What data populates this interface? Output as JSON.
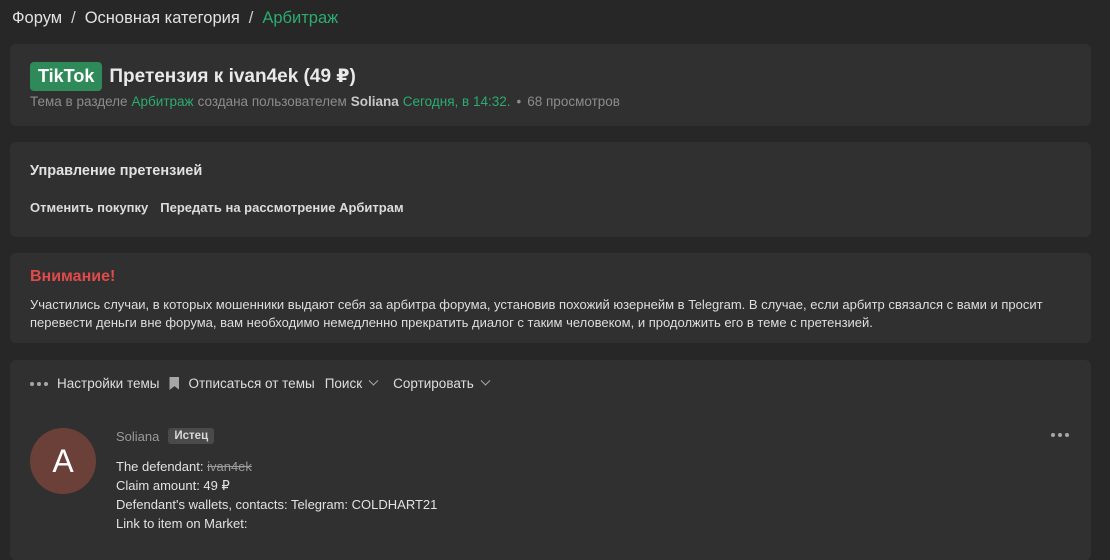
{
  "breadcrumb": {
    "items": [
      "Форум",
      "Основная категория"
    ],
    "current": "Арбитраж",
    "separator": "/"
  },
  "thread": {
    "prefix": "TikTok",
    "title": "Претензия к ivan4ek (49 ₽)",
    "meta": {
      "prefix_text": "Тема в разделе",
      "section": "Арбитраж",
      "created_by": "создана пользователем",
      "author": "Soliana",
      "date": "Сегодня, в 14:32.",
      "dot": "•",
      "views": "68 просмотров"
    }
  },
  "manage": {
    "title": "Управление претензией",
    "actions": [
      "Отменить покупку",
      "Передать на рассмотрение Арбитрам"
    ]
  },
  "notice": {
    "title": "Внимание!",
    "text": "Участились случаи, в которых мошенники выдают себя за арбитра форума, установив похожий юзернейм в Telegram. В случае, если арбитр связался с вами и просит перевести деньги вне форума, вам необходимо немедленно прекратить диалог с таким человеком, и продолжить его в теме с претензией."
  },
  "tools": {
    "settings": "Настройки темы",
    "unsubscribe": "Отписаться от темы",
    "search": "Поиск",
    "sort": "Сортировать"
  },
  "post": {
    "avatar_letter": "A",
    "author": "Soliana",
    "role": "Истец",
    "defendant_label": "The defendant:",
    "defendant": "ivan4ek",
    "claim": "Claim amount: 49 ₽",
    "wallets": "Defendant's wallets, contacts: Telegram: COLDHART21",
    "link": "Link to item on Market:"
  },
  "colors": {
    "accent": "#2bad72",
    "warning": "#e04a4a",
    "prefix_bg": "#2e8a59",
    "avatar_bg": "#6b4038"
  }
}
